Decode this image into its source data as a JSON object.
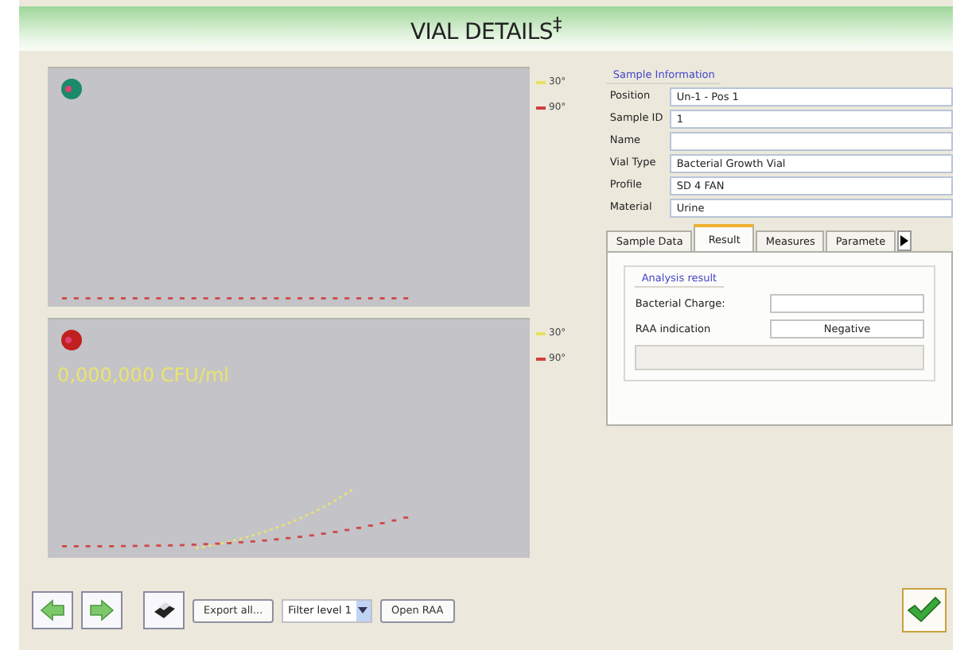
{
  "window": {
    "title": "VIAL DETAILS",
    "title_mark": "‡"
  },
  "charts": [
    {
      "color": "#1a8a6a",
      "legend": [
        {
          "label": "30°",
          "color": "#e8e060"
        },
        {
          "label": "90°",
          "color": "#d04040"
        }
      ]
    },
    {
      "color": "#c02020",
      "reading": "0,000,000 CFU/ml",
      "legend": [
        {
          "label": "30°",
          "color": "#e8e060"
        },
        {
          "label": "90°",
          "color": "#d04040"
        }
      ]
    }
  ],
  "sample_information": {
    "title": "Sample Information",
    "fields": [
      {
        "label": "Position",
        "value": "Un-1 - Pos 1"
      },
      {
        "label": "Sample ID",
        "value": "1"
      },
      {
        "label": "Name"
      },
      {
        "label": "Vial Type",
        "value": "Bacterial Growth Vial"
      },
      {
        "label": "Profile",
        "value": "SD 4 FAN"
      },
      {
        "label": "Material",
        "value": "Urine"
      }
    ]
  },
  "tabs": [
    {
      "label": "Sample Data",
      "selected": false
    },
    {
      "label": "Result",
      "selected": true
    },
    {
      "label": "Measures",
      "selected": false
    },
    {
      "label": "Paramete",
      "selected": false
    }
  ],
  "analysis_result": {
    "title": "Analysis result",
    "rows": [
      {
        "label": "Bacterial Charge:"
      },
      {
        "label": "RAA indication",
        "value": "Negative"
      }
    ]
  },
  "toolbar": {
    "export_button": "Export all...",
    "filter": "Filter level 1",
    "open_button": "Open RAA"
  }
}
